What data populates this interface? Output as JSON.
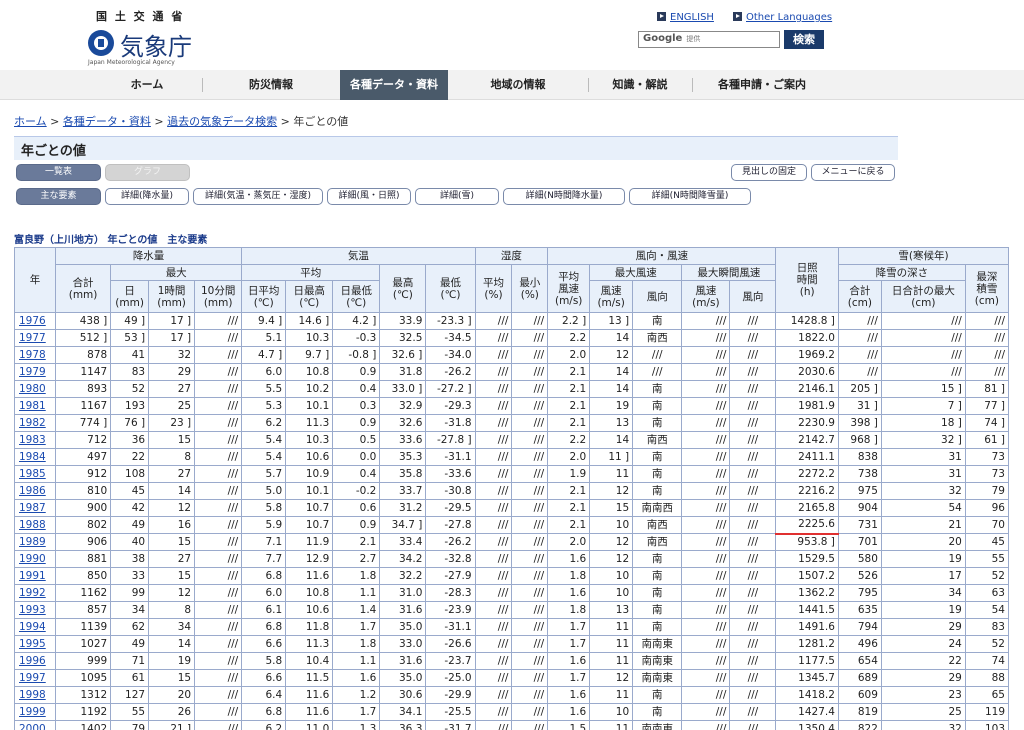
{
  "header": {
    "ministry": "国 土 交 通 省",
    "agency": "気象庁",
    "agency_en": "Japan Meteorological Agency",
    "english_link": "ENGLISH",
    "other_languages_link": "Other Languages",
    "search_google": "Google",
    "search_provided": "提供",
    "search_button": "検索"
  },
  "nav": [
    "ホーム",
    "防災情報",
    "各種データ・資料",
    "地域の情報",
    "知識・解説",
    "各種申請・ご案内"
  ],
  "breadcrumb": {
    "home": "ホーム",
    "data": "各種データ・資料",
    "search": "過去の気象データ検索",
    "current": "年ごとの値",
    "sep": ">"
  },
  "title": "年ごとの値",
  "view_buttons": {
    "list": "一覧表",
    "graph": "グラフ"
  },
  "right_buttons": {
    "fix_header": "見出しの固定",
    "back_menu": "メニューに戻る"
  },
  "element_buttons": [
    "主な要素",
    "詳細(降水量)",
    "詳細(気温・蒸気圧・湿度)",
    "詳細(風・日照)",
    "詳細(雪)",
    "詳細(N時間降水量)",
    "詳細(N時間降雪量)"
  ],
  "caption": "富良野（上川地方） 年ごとの値　主な要素",
  "table_headers": {
    "year": "年",
    "precip": "降水量",
    "temp": "気温",
    "humidity": "湿度",
    "wind": "風向・風速",
    "sunshine": "日照",
    "sunshine_time": "時間",
    "sunshine_unit": "(h)",
    "snow": "雪(寒候年)",
    "total": "合計",
    "total_unit": "(mm)",
    "max": "最大",
    "day": "日",
    "hour1": "1時間",
    "min10": "10分間",
    "mm": "(mm)",
    "avg": "平均",
    "high": "最高",
    "low": "最低",
    "celsius": "(℃)",
    "day_avg": "日平均",
    "day_max": "日最高",
    "day_min": "日最低",
    "hum_avg": "平均",
    "hum_min": "最小",
    "pct": "(%)",
    "avg_wind": "平均",
    "wind_speed": "風速",
    "ms": "(m/s)",
    "max_wind": "最大風速",
    "max_gust": "最大瞬間風速",
    "speed": "風速",
    "direction": "風向",
    "snowfall_depth": "降雪の深さ",
    "snow_total": "合計",
    "snow_daymax": "日合計の最大",
    "cm": "(cm)",
    "deepest": "最深",
    "deepest2": "積雪"
  },
  "rows": [
    [
      "1976",
      "438 ]",
      "49 ]",
      "17 ]",
      "///",
      "9.4 ]",
      "14.6 ]",
      "4.2 ]",
      "33.9",
      "-23.3 ]",
      "///",
      "///",
      "2.2 ]",
      "13 ]",
      "南",
      "///",
      "///",
      "1428.8 ]",
      "///",
      "///",
      "///"
    ],
    [
      "1977",
      "512 ]",
      "53 ]",
      "17 ]",
      "///",
      "5.1",
      "10.3",
      "-0.3",
      "32.5",
      "-34.5",
      "///",
      "///",
      "2.2",
      "14",
      "南西",
      "///",
      "///",
      "1822.0",
      "///",
      "///",
      "///"
    ],
    [
      "1978",
      "878",
      "41",
      "32",
      "///",
      "4.7 ]",
      "9.7 ]",
      "-0.8 ]",
      "32.6 ]",
      "-34.0",
      "///",
      "///",
      "2.0",
      "12",
      "///",
      "///",
      "///",
      "1969.2",
      "///",
      "///",
      "///"
    ],
    [
      "1979",
      "1147",
      "83",
      "29",
      "///",
      "6.0",
      "10.8",
      "0.9",
      "31.8",
      "-26.2",
      "///",
      "///",
      "2.1",
      "14",
      "///",
      "///",
      "///",
      "2030.6",
      "///",
      "///",
      "///"
    ],
    [
      "1980",
      "893",
      "52",
      "27",
      "///",
      "5.5",
      "10.2",
      "0.4",
      "33.0 ]",
      "-27.2 ]",
      "///",
      "///",
      "2.1",
      "14",
      "南",
      "///",
      "///",
      "2146.1",
      "205 ]",
      "15 ]",
      "81 ]"
    ],
    [
      "1981",
      "1167",
      "193",
      "25",
      "///",
      "5.3",
      "10.1",
      "0.3",
      "32.9",
      "-29.3",
      "///",
      "///",
      "2.1",
      "19",
      "南",
      "///",
      "///",
      "1981.9",
      "31 ]",
      "7 ]",
      "77 ]"
    ],
    [
      "1982",
      "774 ]",
      "76 ]",
      "23 ]",
      "///",
      "6.2",
      "11.3",
      "0.9",
      "32.6",
      "-31.8",
      "///",
      "///",
      "2.1",
      "13",
      "南",
      "///",
      "///",
      "2230.9",
      "398 ]",
      "18 ]",
      "74 ]"
    ],
    [
      "1983",
      "712",
      "36",
      "15",
      "///",
      "5.4",
      "10.3",
      "0.5",
      "33.6",
      "-27.8 ]",
      "///",
      "///",
      "2.2",
      "14",
      "南西",
      "///",
      "///",
      "2142.7",
      "968 ]",
      "32 ]",
      "61 ]"
    ],
    [
      "1984",
      "497",
      "22",
      "8",
      "///",
      "5.4",
      "10.6",
      "0.0",
      "35.3",
      "-31.1",
      "///",
      "///",
      "2.0",
      "11 ]",
      "南",
      "///",
      "///",
      "2411.1",
      "838",
      "31",
      "73"
    ],
    [
      "1985",
      "912",
      "108",
      "27",
      "///",
      "5.7",
      "10.9",
      "0.4",
      "35.8",
      "-33.6",
      "///",
      "///",
      "1.9",
      "11",
      "南",
      "///",
      "///",
      "2272.2",
      "738",
      "31",
      "73"
    ],
    [
      "1986",
      "810",
      "45",
      "14",
      "///",
      "5.0",
      "10.1",
      "-0.2",
      "33.7",
      "-30.8",
      "///",
      "///",
      "2.1",
      "12",
      "南",
      "///",
      "///",
      "2216.2",
      "975",
      "32",
      "79"
    ],
    [
      "1987",
      "900",
      "42",
      "12",
      "///",
      "5.8",
      "10.7",
      "0.6",
      "31.2",
      "-29.5",
      "///",
      "///",
      "2.1",
      "15",
      "南南西",
      "///",
      "///",
      "2165.8",
      "904",
      "54",
      "96"
    ],
    [
      "1988",
      "802",
      "49",
      "16",
      "///",
      "5.9",
      "10.7",
      "0.9",
      "34.7 ]",
      "-27.8",
      "///",
      "///",
      "2.1",
      "10",
      "南西",
      "///",
      "///",
      "2225.6",
      "731",
      "21",
      "70"
    ],
    [
      "1989",
      "906",
      "40",
      "15",
      "///",
      "7.1",
      "11.9",
      "2.1",
      "33.4",
      "-26.2",
      "///",
      "///",
      "2.0",
      "12",
      "南西",
      "///",
      "///",
      "953.8 ]",
      "701",
      "20",
      "45"
    ],
    [
      "1990",
      "881",
      "38",
      "27",
      "///",
      "7.7",
      "12.9",
      "2.7",
      "34.2",
      "-32.8",
      "///",
      "///",
      "1.6",
      "12",
      "南",
      "///",
      "///",
      "1529.5",
      "580",
      "19",
      "55"
    ],
    [
      "1991",
      "850",
      "33",
      "15",
      "///",
      "6.8",
      "11.6",
      "1.8",
      "32.2",
      "-27.9",
      "///",
      "///",
      "1.8",
      "10",
      "南",
      "///",
      "///",
      "1507.2",
      "526",
      "17",
      "52"
    ],
    [
      "1992",
      "1162",
      "99",
      "12",
      "///",
      "6.0",
      "10.8",
      "1.1",
      "31.0",
      "-28.3",
      "///",
      "///",
      "1.6",
      "10",
      "南",
      "///",
      "///",
      "1362.2",
      "795",
      "34",
      "63"
    ],
    [
      "1993",
      "857",
      "34",
      "8",
      "///",
      "6.1",
      "10.6",
      "1.4",
      "31.6",
      "-23.9",
      "///",
      "///",
      "1.8",
      "13",
      "南",
      "///",
      "///",
      "1441.5",
      "635",
      "19",
      "54"
    ],
    [
      "1994",
      "1139",
      "62",
      "34",
      "///",
      "6.8",
      "11.8",
      "1.7",
      "35.0",
      "-31.1",
      "///",
      "///",
      "1.7",
      "11",
      "南",
      "///",
      "///",
      "1491.6",
      "794",
      "29",
      "83"
    ],
    [
      "1995",
      "1027",
      "49",
      "14",
      "///",
      "6.6",
      "11.3",
      "1.8",
      "33.0",
      "-26.6",
      "///",
      "///",
      "1.7",
      "11",
      "南南東",
      "///",
      "///",
      "1281.2",
      "496",
      "24",
      "52"
    ],
    [
      "1996",
      "999",
      "71",
      "19",
      "///",
      "5.8",
      "10.4",
      "1.1",
      "31.6",
      "-23.7",
      "///",
      "///",
      "1.6",
      "11",
      "南南東",
      "///",
      "///",
      "1177.5",
      "654",
      "22",
      "74"
    ],
    [
      "1997",
      "1095",
      "61",
      "15",
      "///",
      "6.6",
      "11.5",
      "1.6",
      "35.0",
      "-25.0",
      "///",
      "///",
      "1.7",
      "12",
      "南南東",
      "///",
      "///",
      "1345.7",
      "689",
      "29",
      "88"
    ],
    [
      "1998",
      "1312",
      "127",
      "20",
      "///",
      "6.4",
      "11.6",
      "1.2",
      "30.6",
      "-29.9",
      "///",
      "///",
      "1.6",
      "11",
      "南",
      "///",
      "///",
      "1418.2",
      "609",
      "23",
      "65"
    ],
    [
      "1999",
      "1192",
      "55",
      "26",
      "///",
      "6.8",
      "11.6",
      "1.7",
      "34.1",
      "-25.5",
      "///",
      "///",
      "1.6",
      "10",
      "南",
      "///",
      "///",
      "1427.4",
      "819",
      "25",
      "119"
    ],
    [
      "2000",
      "1402",
      "79",
      "21 ]",
      "///",
      "6.2",
      "11.0",
      "1.3",
      "36.3",
      "-31.7",
      "///",
      "///",
      "1.5",
      "11",
      "南南東",
      "///",
      "///",
      "1350.4",
      "822",
      "32",
      "103"
    ]
  ]
}
